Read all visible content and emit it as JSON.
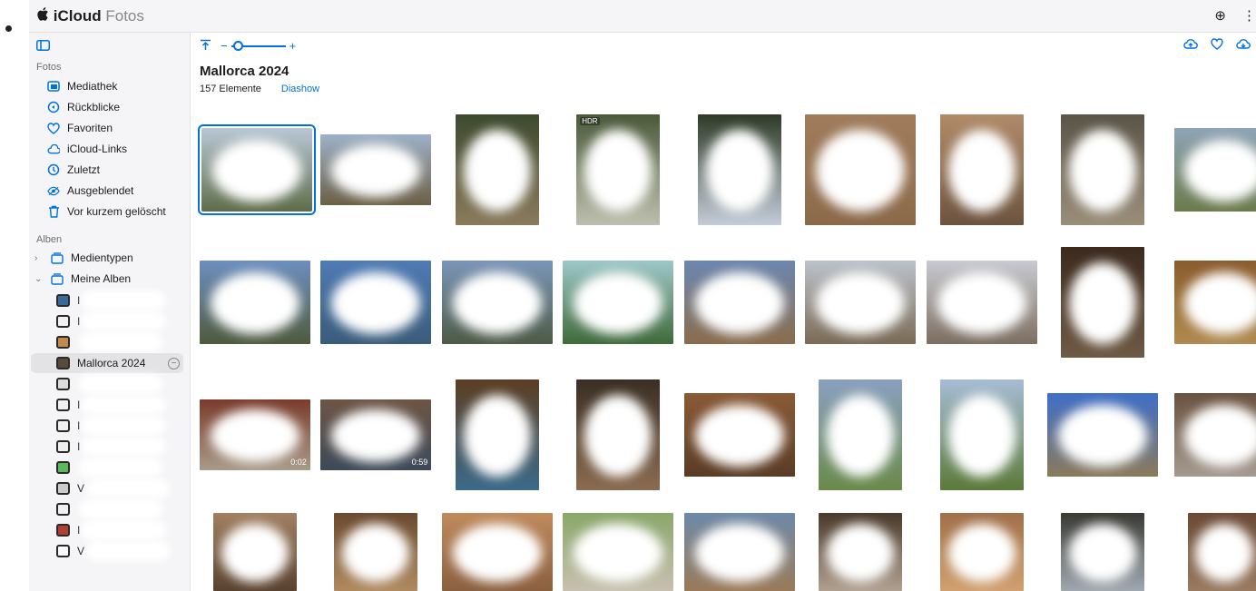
{
  "titlebar": {
    "brand_icloud": "iCloud",
    "brand_fotos": "Fotos",
    "add_icon": "⊕",
    "more_icon": "⋮"
  },
  "sidebar": {
    "section_fotos": "Fotos",
    "items": [
      {
        "label": "Mediathek",
        "icon": "library-icon"
      },
      {
        "label": "Rückblicke",
        "icon": "memories-icon"
      },
      {
        "label": "Favoriten",
        "icon": "heart-icon"
      },
      {
        "label": "iCloud-Links",
        "icon": "link-icon"
      },
      {
        "label": "Zuletzt",
        "icon": "clock-icon"
      },
      {
        "label": "Ausgeblendet",
        "icon": "eye-hidden-icon"
      },
      {
        "label": "Vor kurzem gelöscht",
        "icon": "trash-icon"
      }
    ],
    "section_alben": "Alben",
    "groups": [
      {
        "label": "Medientypen",
        "expanded": false
      },
      {
        "label": "Meine Alben",
        "expanded": true
      }
    ],
    "albums": [
      {
        "label": "I",
        "selected": false
      },
      {
        "label": "I",
        "selected": false
      },
      {
        "label": "",
        "selected": false
      },
      {
        "label": "Mallorca 2024",
        "selected": true
      },
      {
        "label": "",
        "selected": false
      },
      {
        "label": "I",
        "selected": false
      },
      {
        "label": "I",
        "selected": false
      },
      {
        "label": "I",
        "selected": false
      },
      {
        "label": "",
        "selected": false
      },
      {
        "label": "V",
        "selected": false
      },
      {
        "label": "",
        "selected": false
      },
      {
        "label": "I",
        "selected": false
      },
      {
        "label": "V",
        "selected": false
      }
    ]
  },
  "main": {
    "zoom_minus": "−",
    "zoom_plus": "+",
    "zoom_level": 0.1,
    "title": "Mallorca 2024",
    "count": "157 Elemente",
    "slideshow": "Diashow",
    "photos": [
      {
        "duration": "",
        "hdr": "",
        "colors": [
          "#b9c7d6",
          "#5f6d4a"
        ]
      },
      {
        "duration": "",
        "hdr": "",
        "colors": [
          "#9db1c8",
          "#6c5f45"
        ]
      },
      {
        "duration": "",
        "hdr": "",
        "colors": [
          "#3d4a2f",
          "#8a7a5c"
        ]
      },
      {
        "duration": "",
        "hdr": "HDR",
        "colors": [
          "#4b5a3a",
          "#bdbfae"
        ]
      },
      {
        "duration": "",
        "hdr": "",
        "colors": [
          "#2f3b27",
          "#c3ccd8"
        ]
      },
      {
        "duration": "",
        "hdr": "",
        "colors": [
          "#a07c5c",
          "#8b6a4a"
        ]
      },
      {
        "duration": "",
        "hdr": "",
        "colors": [
          "#b08b69",
          "#6d5440"
        ]
      },
      {
        "duration": "",
        "hdr": "",
        "colors": [
          "#5a5548",
          "#9a8e79"
        ]
      },
      {
        "duration": "",
        "hdr": "",
        "colors": [
          "#8fa5b8",
          "#6b7a4a"
        ]
      },
      {
        "duration": "",
        "hdr": "",
        "colors": [
          "#6d8fc0",
          "#4f5a3c"
        ]
      },
      {
        "duration": "",
        "hdr": "",
        "colors": [
          "#4f7bb5",
          "#3a5c7a"
        ]
      },
      {
        "duration": "",
        "hdr": "",
        "colors": [
          "#7a96b8",
          "#4e5a46"
        ]
      },
      {
        "duration": "",
        "hdr": "",
        "colors": [
          "#9ec8c8",
          "#3f6a3a"
        ]
      },
      {
        "duration": "",
        "hdr": "",
        "colors": [
          "#6b87b0",
          "#8a6c4c"
        ]
      },
      {
        "duration": "",
        "hdr": "",
        "colors": [
          "#bcc3cc",
          "#7a6a55"
        ]
      },
      {
        "duration": "",
        "hdr": "",
        "colors": [
          "#c8cbd2",
          "#7c6e60"
        ]
      },
      {
        "duration": "",
        "hdr": "",
        "colors": [
          "#3b2a1e",
          "#6e5a45"
        ]
      },
      {
        "duration": "",
        "hdr": "",
        "colors": [
          "#8a5c2e",
          "#b08a50"
        ]
      },
      {
        "duration": "0:02",
        "hdr": "",
        "colors": [
          "#7a3c2c",
          "#a89a88"
        ]
      },
      {
        "duration": "0:59",
        "hdr": "",
        "colors": [
          "#6e5545",
          "#3c4a5a"
        ]
      },
      {
        "duration": "",
        "hdr": "",
        "colors": [
          "#5c3e22",
          "#3b6a8a"
        ]
      },
      {
        "duration": "",
        "hdr": "",
        "colors": [
          "#3a2f25",
          "#8a6c50"
        ]
      },
      {
        "duration": "",
        "hdr": "",
        "colors": [
          "#8a5a36",
          "#5a3c26"
        ]
      },
      {
        "duration": "",
        "hdr": "",
        "colors": [
          "#8aa0c0",
          "#6a8a4a"
        ]
      },
      {
        "duration": "",
        "hdr": "",
        "colors": [
          "#a6bcd6",
          "#5c7a3a"
        ]
      },
      {
        "duration": "",
        "hdr": "",
        "colors": [
          "#3f6fc8",
          "#8a7a5a"
        ]
      },
      {
        "duration": "",
        "hdr": "",
        "colors": [
          "#6a5240",
          "#a49a90"
        ]
      },
      {
        "duration": "",
        "hdr": "",
        "colors": [
          "#a08060",
          "#5a4230"
        ]
      },
      {
        "duration": "",
        "hdr": "",
        "colors": [
          "#6a4a30",
          "#b08a60"
        ]
      },
      {
        "duration": "",
        "hdr": "",
        "colors": [
          "#c08a5c",
          "#8a6040"
        ]
      },
      {
        "duration": "",
        "hdr": "",
        "colors": [
          "#8aa86a",
          "#c8c0b0"
        ]
      },
      {
        "duration": "",
        "hdr": "",
        "colors": [
          "#6e8aa8",
          "#9a7a58"
        ]
      },
      {
        "duration": "",
        "hdr": "",
        "colors": [
          "#4a3a2c",
          "#b0a090"
        ]
      },
      {
        "duration": "",
        "hdr": "",
        "colors": [
          "#a0704a",
          "#d0a070"
        ]
      },
      {
        "duration": "",
        "hdr": "",
        "colors": [
          "#3a3a34",
          "#a0a8b0"
        ]
      },
      {
        "duration": "",
        "hdr": "",
        "colors": [
          "#6a4a36",
          "#9a7a60"
        ]
      }
    ]
  }
}
